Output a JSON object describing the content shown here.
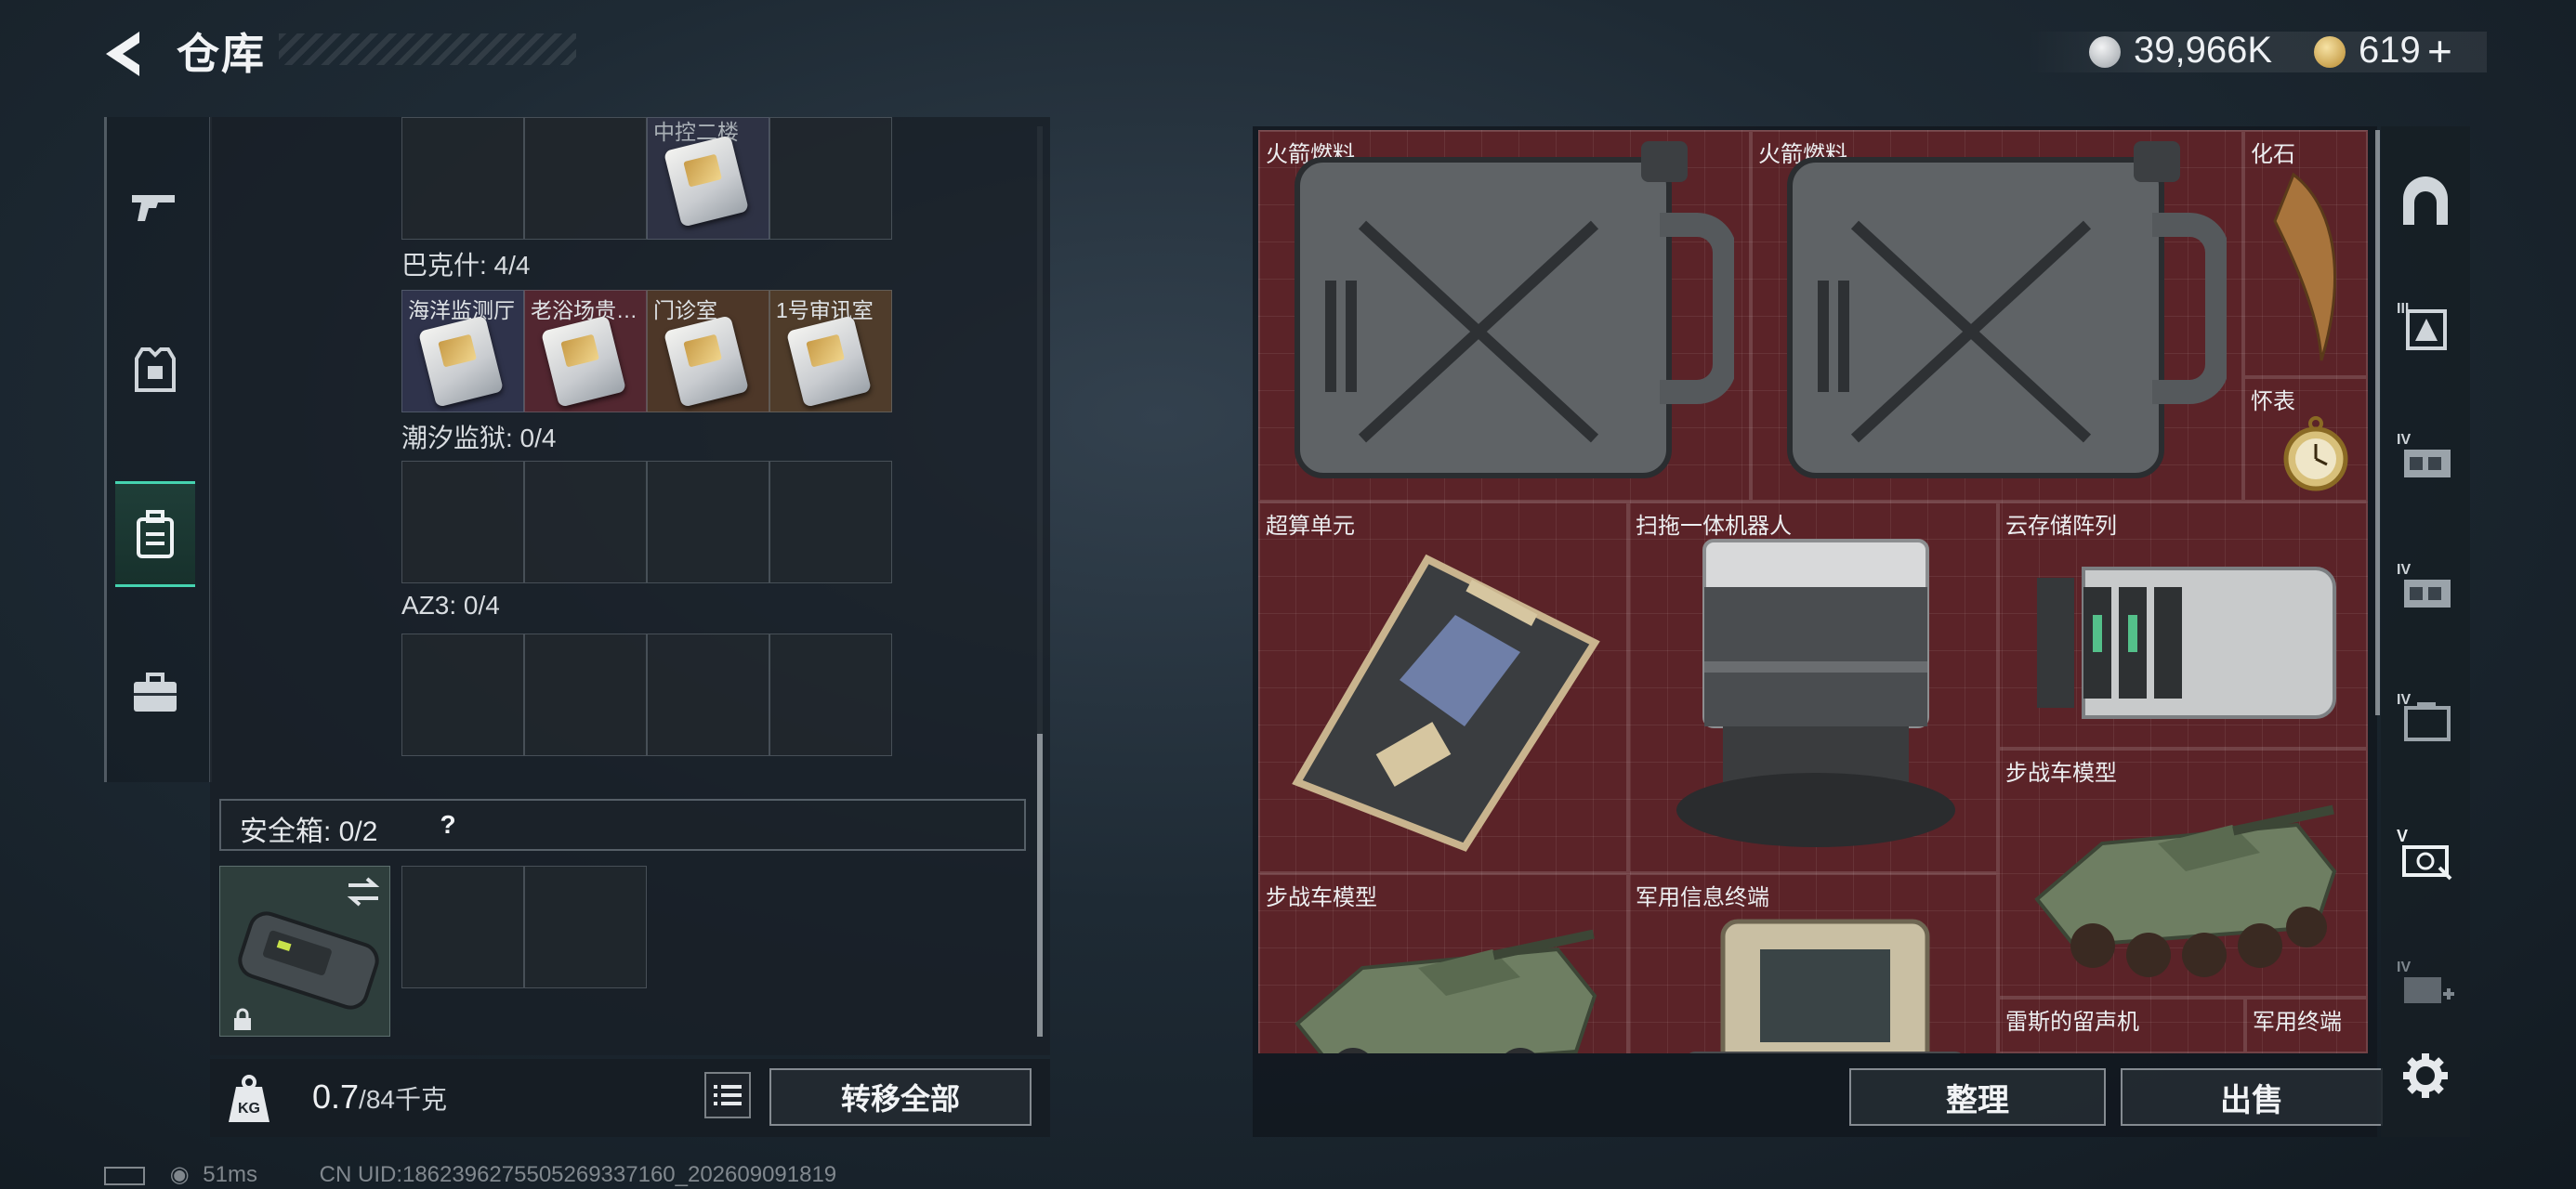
{
  "header": {
    "title": "仓库",
    "currency": [
      {
        "icon": "silver-coin-icon",
        "value": "39,966K",
        "color": "#c9ccd0"
      },
      {
        "icon": "gold-triangle-coin-icon",
        "value": "619",
        "color": "#d8b45a"
      }
    ],
    "add_symbol": "+"
  },
  "left_tabs": [
    {
      "icon": "gun-icon",
      "active": false
    },
    {
      "icon": "armor-vest-icon",
      "active": false
    },
    {
      "icon": "backpack-icon",
      "active": true
    },
    {
      "icon": "briefcase-icon",
      "active": false
    }
  ],
  "key_sections": [
    {
      "title": "",
      "top_partial_label": "中控二楼",
      "slots": 4
    },
    {
      "title": "巴克什: 4/4",
      "cards": [
        "海洋监测厅",
        "老浴场贵…",
        "门诊室",
        "1号审讯室"
      ]
    },
    {
      "title": "潮汐监狱: 0/4",
      "cards": []
    },
    {
      "title": "AZ3: 0/4",
      "cards": []
    }
  ],
  "safe_box": {
    "label": "安全箱: 0/2",
    "help": "?",
    "icons": [
      "swap-icon",
      "lock-icon"
    ]
  },
  "weight": {
    "current": "0.7",
    "max": "/84",
    "unit": "千克",
    "icon_text": "KG"
  },
  "buttons": {
    "transfer_all": "转移全部",
    "sort": "整理",
    "sell": "出售"
  },
  "stash_items": [
    {
      "name": "火箭燃料",
      "label": "火箭燃料",
      "icon": "fuel-canister-icon"
    },
    {
      "name": "火箭燃料",
      "label": "火箭燃料",
      "icon": "fuel-canister-icon"
    },
    {
      "name": "化石",
      "label": "化石",
      "icon": "fossil-claw-icon"
    },
    {
      "name": "怀表",
      "label": "怀表",
      "icon": "pocket-watch-icon"
    },
    {
      "name": "超算单元",
      "label": "超算单元",
      "icon": "supercomputer-board-icon"
    },
    {
      "name": "扫拖一体机器人",
      "label": "扫拖一体机器人",
      "icon": "robot-vacuum-icon"
    },
    {
      "name": "云存储阵列",
      "label": "云存储阵列",
      "icon": "storage-array-icon"
    },
    {
      "name": "步战车模型",
      "label": "步战车模型",
      "icon": "ifv-model-icon"
    },
    {
      "name": "步战车模型",
      "label": "步战车模型",
      "icon": "ifv-model-icon"
    },
    {
      "name": "军用信息终端",
      "label": "军用信息终端",
      "icon": "military-terminal-icon"
    },
    {
      "name": "雷斯的留声机",
      "label": "雷斯的留声机",
      "icon": "gramophone-icon"
    },
    {
      "name": "军用终端",
      "label": "军用终端",
      "icon": "terminal-icon"
    }
  ],
  "right_rail": [
    {
      "icon": "arch-gate-icon"
    },
    {
      "icon": "level-iii-armor-icon",
      "tag": "III"
    },
    {
      "icon": "level-iv-rig-icon",
      "tag": "IV"
    },
    {
      "icon": "level-iv-rig-icon",
      "tag": "IV"
    },
    {
      "icon": "level-iv-case-icon",
      "tag": "IV"
    },
    {
      "icon": "level-v-container-icon",
      "tag": "V"
    },
    {
      "icon": "level-iv-add-icon",
      "tag": "IV"
    },
    {
      "icon": "settings-gear-icon"
    }
  ],
  "status_bar": {
    "ping": "51ms",
    "uid": "CN UID:1862396275505269337160_202609091819"
  }
}
